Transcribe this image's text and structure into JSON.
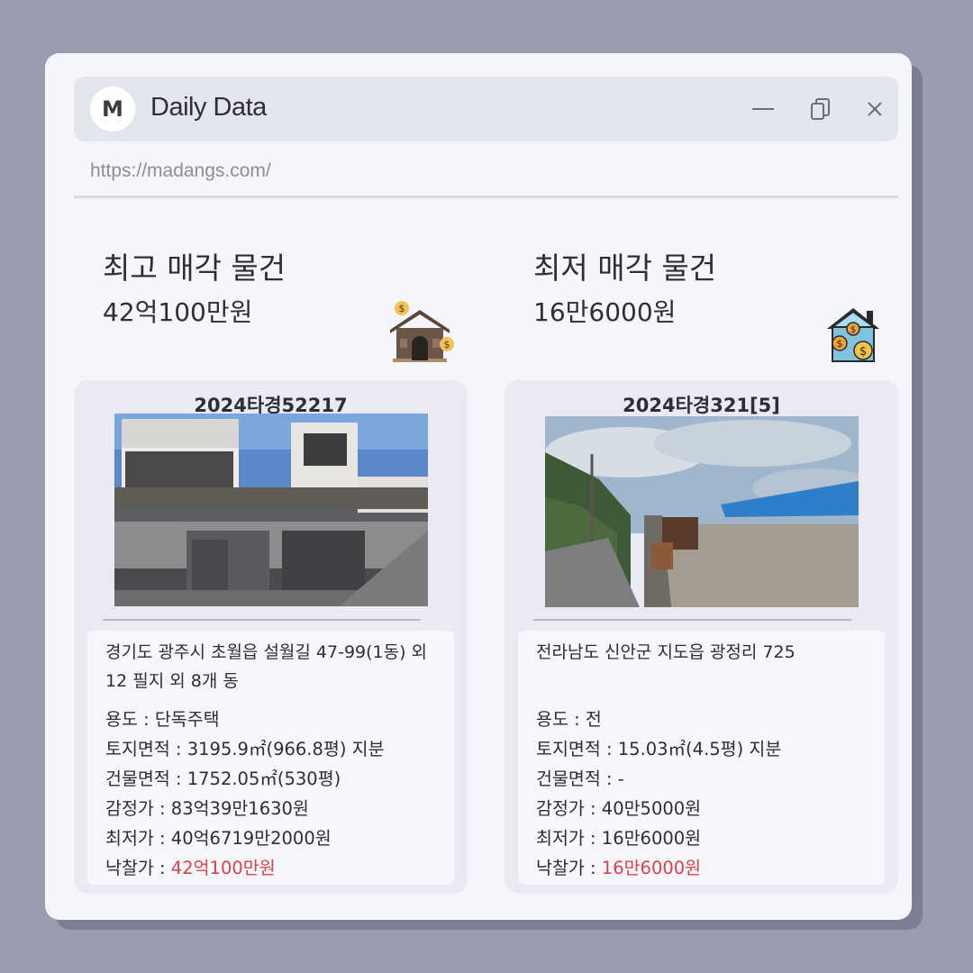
{
  "window": {
    "logo_letter": "M",
    "title": "Daily Data",
    "url": "https://madangs.com/"
  },
  "highest": {
    "heading": "최고 매각 물건",
    "amount": "42억100만원",
    "case_no": "2024타경52217",
    "address": "경기도 광주시 초월읍 설월길 47-99(1동) 외 12 필지 외 8개 동",
    "usage_label": "용도 : ",
    "usage": "단독주택",
    "land_label": "토지면적 : ",
    "land_area": "3195.9㎡(966.8평) 지분",
    "building_label": "건물면적 : ",
    "building_area": "1752.05㎡(530평)",
    "appraisal_label": "감정가 : ",
    "appraisal": "83억39만1630원",
    "minimum_label": "최저가 : ",
    "minimum": "40억6719만2000원",
    "winning_label": "낙찰가 : ",
    "winning": "42억100만원"
  },
  "lowest": {
    "heading": "최저 매각 물건",
    "amount": "16만6000원",
    "case_no": "2024타경321[5]",
    "address": "전라남도 신안군 지도읍 광정리 725",
    "usage_label": "용도 : ",
    "usage": "전",
    "land_label": "토지면적 : ",
    "land_area": "15.03㎡(4.5평) 지분",
    "building_label": "건물면적 : ",
    "building_area": "-",
    "appraisal_label": "감정가 : ",
    "appraisal": "40만5000원",
    "minimum_label": "최저가 : ",
    "minimum": "16만6000원",
    "winning_label": "낙찰가 : ",
    "winning": "16만6000원"
  },
  "colors": {
    "background": "#9a9cb0",
    "window": "#f5f6fc",
    "titlebar": "#e4e6ee",
    "card": "#e9eaf3",
    "highlight_red": "#e0404a"
  }
}
